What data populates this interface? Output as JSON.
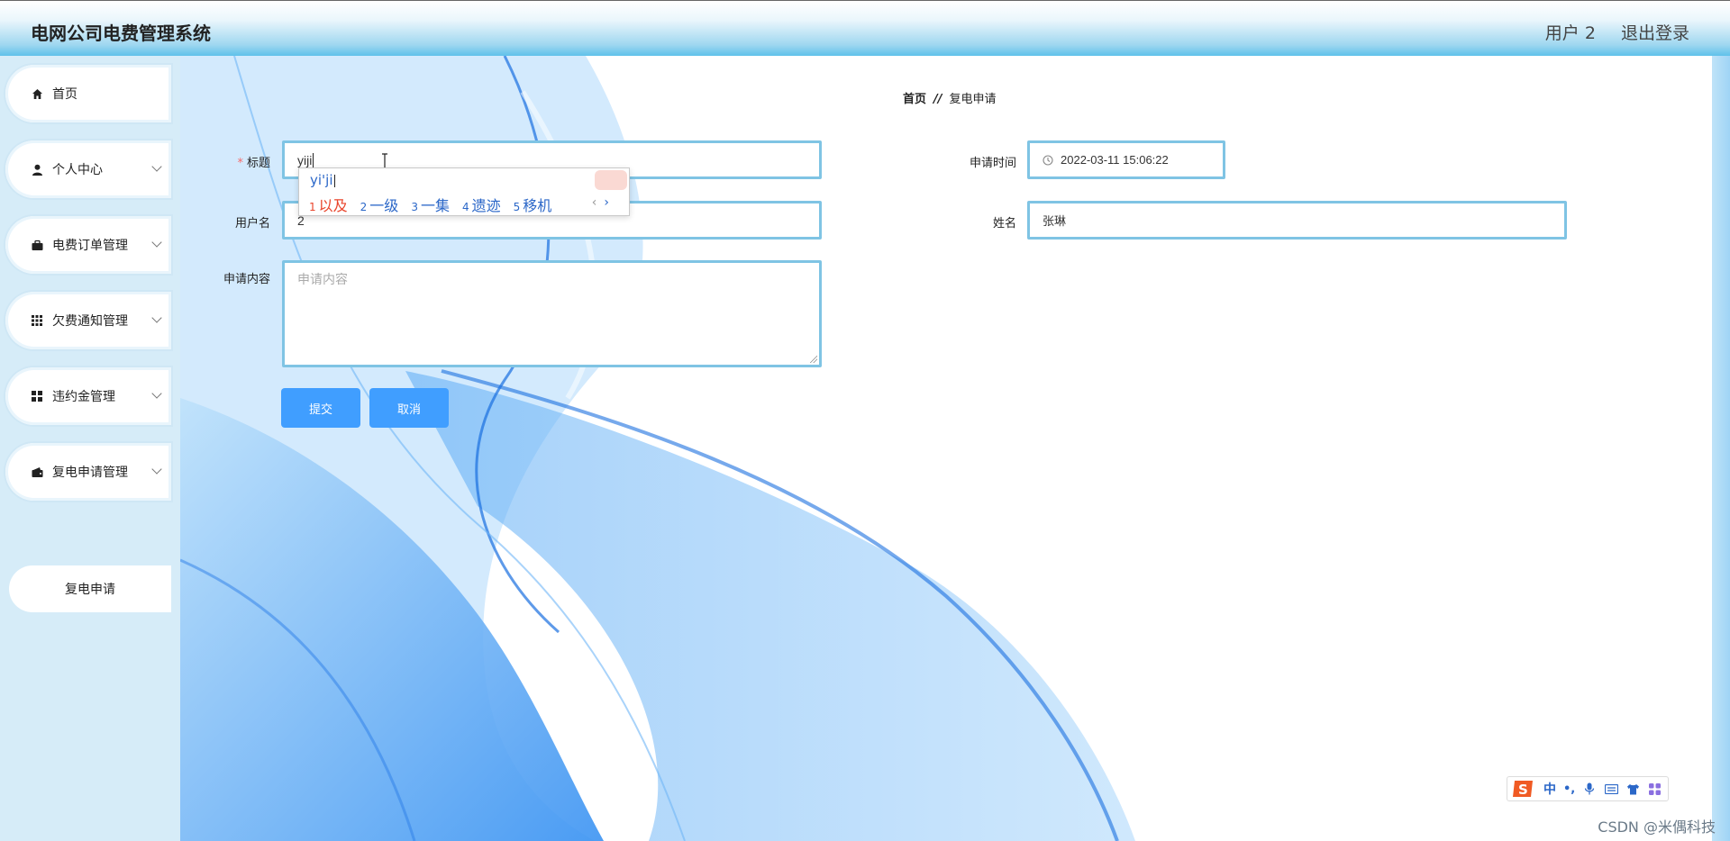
{
  "header": {
    "app_title": "电网公司电费管理系统",
    "user_label": "用户 2",
    "logout_label": "退出登录"
  },
  "sidebar": {
    "items": [
      {
        "label": "首页",
        "icon": "home-icon"
      },
      {
        "label": "个人中心",
        "icon": "user-icon"
      },
      {
        "label": "电费订单管理",
        "icon": "briefcase-icon"
      },
      {
        "label": "欠费通知管理",
        "icon": "grid-icon"
      },
      {
        "label": "违约金管理",
        "icon": "apps-icon"
      },
      {
        "label": "复电申请管理",
        "icon": "wallet-icon"
      }
    ],
    "submenu_item": "复电申请"
  },
  "breadcrumb": {
    "home": "首页",
    "separator": "//",
    "current": "复电申请"
  },
  "form": {
    "title_label": "标题",
    "title_value": "yiji",
    "apply_time_label": "申请时间",
    "apply_time_value": "2022-03-11 15:06:22",
    "username_label": "用户名",
    "username_value": "2",
    "name_label": "姓名",
    "name_value": "张琳",
    "content_label": "申请内容",
    "content_placeholder": "申请内容",
    "submit_label": "提交",
    "cancel_label": "取消"
  },
  "ime_popup": {
    "composition": "yi'ji",
    "candidates": [
      {
        "num": "1",
        "text": "以及"
      },
      {
        "num": "2",
        "text": "一级"
      },
      {
        "num": "3",
        "text": "一集"
      },
      {
        "num": "4",
        "text": "遗迹"
      },
      {
        "num": "5",
        "text": "移机"
      }
    ],
    "prev": "‹",
    "next": "›"
  },
  "ime_toolbar": {
    "mode_label": "中",
    "punct_label": "•,"
  },
  "watermark": "CSDN @米偶科技",
  "colors": {
    "primary_button": "#409eff",
    "field_border": "#7fc4e4",
    "required_mark": "#f56c6c",
    "ime_candidate": "#2b67c8",
    "ime_first_candidate": "#e9442b"
  }
}
